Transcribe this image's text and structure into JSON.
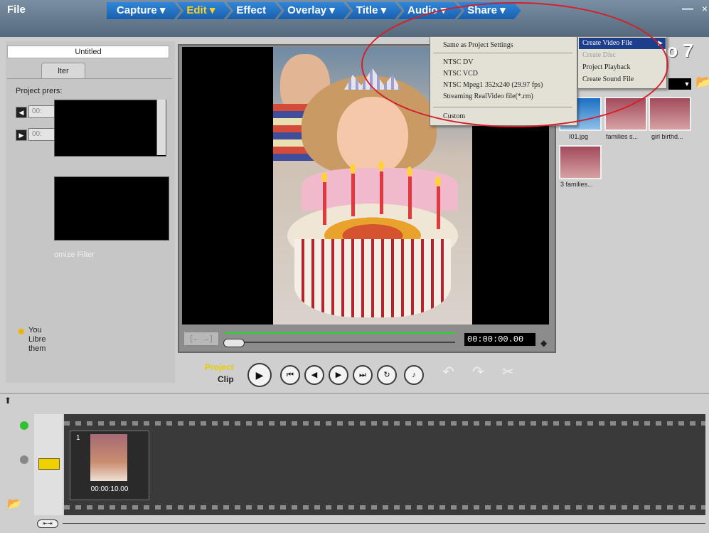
{
  "menubar": {
    "file": "File",
    "steps": [
      "Capture ▾",
      "Edit ▾",
      "Effect",
      "Overlay ▾",
      "Title ▾",
      "Audio ▾",
      "Share ▾"
    ],
    "minimize": "—",
    "close": "×"
  },
  "left_panel": {
    "title_field": "Untitled",
    "filter_tab": "lter",
    "project_label": "Project prers:",
    "time_in": "00:",
    "time_out": "00:",
    "customize_filter": "omize Filter",
    "tip": [
      "You",
      "Libre",
      "them"
    ]
  },
  "preview": {
    "timecode": "00:00:00.00",
    "frame_buttons": "[← →]",
    "project_label": "Project",
    "clip_label": "Clip"
  },
  "library": {
    "logo": "io 7",
    "items": [
      {
        "caption": "I01.jpg"
      },
      {
        "caption": "families s..."
      },
      {
        "caption": "girl birthd..."
      },
      {
        "caption": "3 families..."
      }
    ]
  },
  "share_menu": {
    "items": [
      "Same as Project Settings",
      "NTSC  DV",
      "NTSC  VCD",
      "NTSC   Mpeg1 352x240 (29.97 fps)",
      "Streaming RealVideo file(*.rm)",
      "Custom"
    ],
    "submenu": [
      "Create Video File",
      "Create Disc",
      "Project Playback",
      "Create Sound File"
    ]
  },
  "timeline": {
    "clip_number": "1",
    "clip_duration": "00:00:10.00"
  },
  "colors": {
    "step_blue": "#1b5fae",
    "active_step": "#ffd21c",
    "highlight": "#1d3f8b",
    "annotation_red": "#d41e2a"
  }
}
